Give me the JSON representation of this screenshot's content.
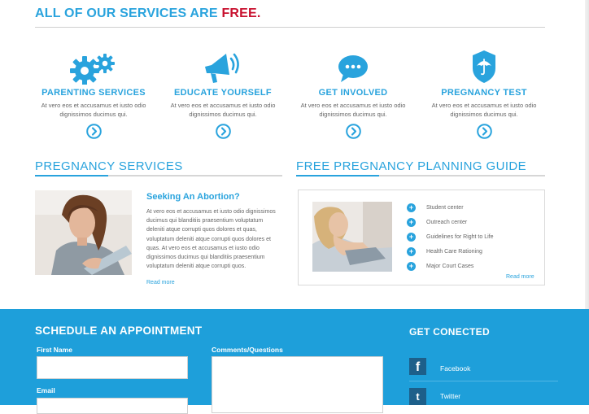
{
  "header": {
    "headline": "ALL OF OUR SERVICES ARE",
    "headline_emphasis": "FREE."
  },
  "services": [
    {
      "title": "PARENTING SERVICES",
      "desc": "At vero eos et accusamus et iusto odio dignissimos ducimus qui.",
      "icon": "gears-icon"
    },
    {
      "title": "EDUCATE YOURSELF",
      "desc": "At vero eos et accusamus et iusto odio dignissimos ducimus qui.",
      "icon": "megaphone-icon"
    },
    {
      "title": "GET INVOLVED",
      "desc": "At vero eos et accusamus et iusto odio dignissimos ducimus qui.",
      "icon": "speech-bubble-icon"
    },
    {
      "title": "PREGNANCY TEST",
      "desc": "At vero eos et accusamus et iusto odio dignissimos ducimus qui.",
      "icon": "umbrella-shield-icon"
    }
  ],
  "pregnancy_services": {
    "section_title": "PREGNANCY SERVICES",
    "heading": "Seeking An Abortion?",
    "body": "At vero eos et accusamus et iusto odio dignissimos ducimus qui blanditiis praesentium voluptatum deleniti atque corrupti quos dolores et quas, voluptatum deleniti atque corrupti quos dolores et quas. At vero eos et accusamus et iusto odio dignissimos ducimus qui blanditiis praesentium voluptatum deleniti atque corrupti quos.",
    "read_more": "Read more"
  },
  "guide": {
    "section_title": "FREE PREGNANCY PLANNING GUIDE",
    "items": [
      "Student center",
      "Outreach center",
      "Guidelines for Right to Life",
      "Health Care Rationing",
      "Major Court Cases"
    ],
    "read_more": "Read more"
  },
  "appointment": {
    "title": "SCHEDULE AN APPOINTMENT",
    "first_name_label": "First Name",
    "email_label": "Email",
    "comments_label": "Comments/Questions"
  },
  "connect": {
    "title": "GET CONECTED",
    "links": [
      {
        "label": "Facebook",
        "icon": "facebook-icon",
        "glyph": "f"
      },
      {
        "label": "Twitter",
        "icon": "twitter-icon",
        "glyph": "t"
      }
    ]
  },
  "colors": {
    "accent": "#29a3dd",
    "free": "#c8102e",
    "footer": "#1e9fda"
  }
}
